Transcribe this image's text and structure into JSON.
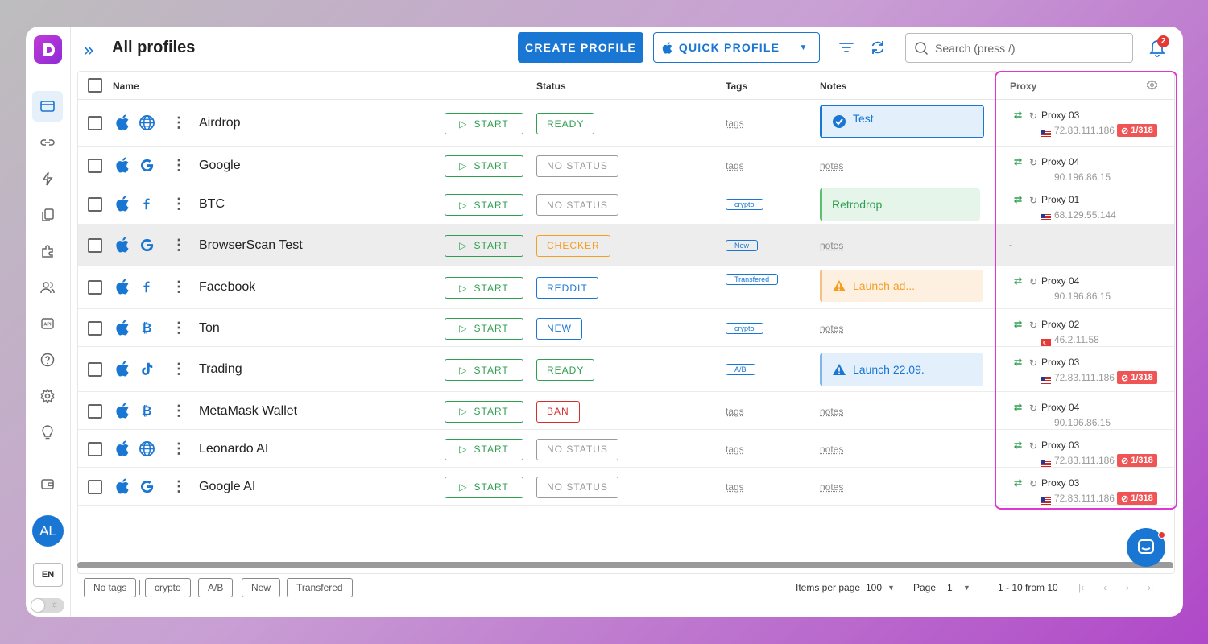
{
  "app": {
    "title": "All profiles",
    "colors": {
      "primary": "#1976d2",
      "success": "#2e9e4f",
      "danger": "#e53935",
      "highlight": "#e136d6"
    }
  },
  "toolbar": {
    "create_label": "CREATE PROFILE",
    "quick_label": "QUICK PROFILE",
    "search_placeholder": "Search (press /)",
    "notifications_count": "2"
  },
  "sidebar": {
    "items": [
      "profiles-icon",
      "link-icon",
      "automation-icon",
      "copy-icon",
      "extensions-icon",
      "team-icon",
      "api-icon",
      "help-icon",
      "settings-icon",
      "idea-icon",
      "wallet-icon"
    ],
    "avatar": "AL",
    "language": "EN"
  },
  "table": {
    "headers": {
      "name": "Name",
      "status": "Status",
      "tags": "Tags",
      "notes": "Notes",
      "proxy": "Proxy"
    },
    "start_label": "START",
    "rows": [
      {
        "name": "Airdrop",
        "site_icon": "globe-icon",
        "status": "READY",
        "tag": "tags",
        "note": "Test",
        "proxy": "Proxy 03",
        "ip": "72.83.111.186",
        "ban": "1/318"
      },
      {
        "name": "Google",
        "site_icon": "google-icon",
        "status": "NO STATUS",
        "tag": "tags",
        "note": "notes",
        "proxy": "Proxy 04",
        "ip": "90.196.86.15"
      },
      {
        "name": "BTC",
        "site_icon": "facebook-icon",
        "status": "NO STATUS",
        "tag": "crypto",
        "note": "Retrodrop",
        "proxy": "Proxy 01",
        "ip": "68.129.55.144"
      },
      {
        "name": "BrowserScan Test",
        "site_icon": "google-icon",
        "status": "CHECKER",
        "tag": "New",
        "note": "notes",
        "proxy": "-"
      },
      {
        "name": "Facebook",
        "site_icon": "facebook-icon",
        "status": "REDDIT",
        "tag": "Transfered",
        "note": "Launch ad...",
        "proxy": "Proxy 04",
        "ip": "90.196.86.15"
      },
      {
        "name": "Ton",
        "site_icon": "bitcoin-icon",
        "status": "NEW",
        "tag": "crypto",
        "note": "notes",
        "proxy": "Proxy 02",
        "ip": "46.2.11.58"
      },
      {
        "name": "Trading",
        "site_icon": "tiktok-icon",
        "status": "READY",
        "tag": "A/B",
        "note": "Launch 22.09.",
        "proxy": "Proxy 03",
        "ip": "72.83.111.186",
        "ban": "1/318"
      },
      {
        "name": "MetaMask Wallet",
        "site_icon": "bitcoin-icon",
        "status": "BAN",
        "tag": "tags",
        "note": "notes",
        "proxy": "Proxy 04",
        "ip": "90.196.86.15"
      },
      {
        "name": "Leonardo AI",
        "site_icon": "globe-icon",
        "status": "NO STATUS",
        "tag": "tags",
        "note": "notes",
        "proxy": "Proxy 03",
        "ip": "72.83.111.186",
        "ban": "1/318"
      },
      {
        "name": "Google AI",
        "site_icon": "google-icon",
        "status": "NO STATUS",
        "tag": "tags",
        "note": "notes",
        "proxy": "Proxy 03",
        "ip": "72.83.111.186",
        "ban": "1/318"
      }
    ]
  },
  "footer": {
    "tag_filters": [
      "No tags",
      "crypto",
      "A/B",
      "New",
      "Transfered"
    ],
    "items_per_page_label": "Items per page",
    "items_per_page": "100",
    "page_label": "Page",
    "page": "1",
    "range": "1 - 10 from 10"
  }
}
